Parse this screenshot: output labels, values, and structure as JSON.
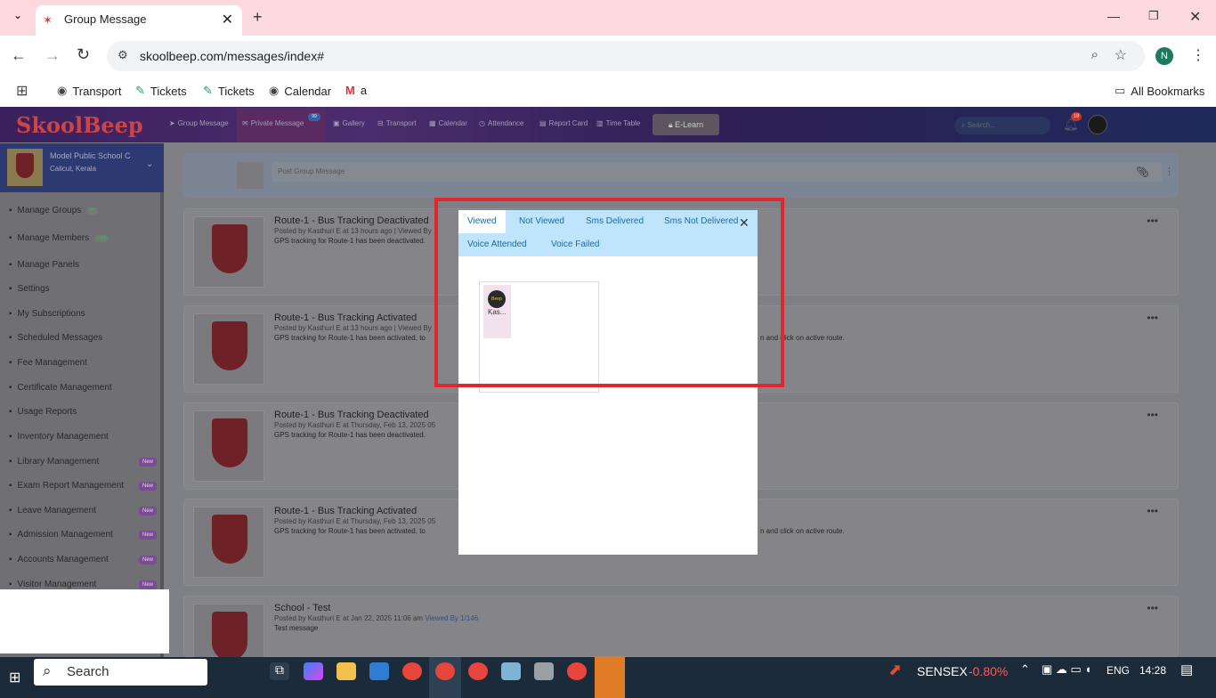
{
  "browser": {
    "tab_title": "Group Message",
    "url": "skoolbeep.com/messages/index#",
    "profile_initial": "N",
    "bookmarks": [
      "Transport",
      "Tickets",
      "Tickets",
      "Calendar",
      "a"
    ],
    "all_bookmarks": "All Bookmarks"
  },
  "app": {
    "logo": "SkoolBeep",
    "nav": [
      "Group Message",
      "Private Message",
      "Gallery",
      "Transport",
      "Calendar",
      "Attendance",
      "Report Card",
      "Time Table"
    ],
    "elearn": "E-Learn",
    "search_placeholder": "Search...",
    "notif_count": "18",
    "private_badge": "99",
    "school_name": "Model Public School C",
    "school_location": "Calicut, Kerala",
    "post_placeholder": "Post Group Message",
    "new_label": "New"
  },
  "sidebar": [
    {
      "label": "Manage Groups",
      "badge": "60"
    },
    {
      "label": "Manage Members",
      "badge": "189"
    },
    {
      "label": "Manage Panels"
    },
    {
      "label": "Settings"
    },
    {
      "label": "My Subscriptions"
    },
    {
      "label": "Scheduled Messages"
    },
    {
      "label": "Fee Management"
    },
    {
      "label": "Certificate Management"
    },
    {
      "label": "Usage Reports"
    },
    {
      "label": "Inventory Management"
    },
    {
      "label": "Library Management",
      "new": true
    },
    {
      "label": "Exam Report Management",
      "new": true
    },
    {
      "label": "Leave Management",
      "new": true
    },
    {
      "label": "Admission Management",
      "new": true
    },
    {
      "label": "Accounts Management",
      "new": true
    },
    {
      "label": "Visitor Management",
      "new": true
    }
  ],
  "posts": [
    {
      "title": "Route-1 - Bus Tracking Deactivated",
      "meta": "Posted by Kasthuri E at 13 hours ago | Viewed By",
      "body": "GPS tracking for Route-1 has been deactivated."
    },
    {
      "title": "Route-1 - Bus Tracking Activated",
      "meta": "Posted by Kasthuri E at 13 hours ago | Viewed By",
      "body": "GPS tracking for Route-1 has been activated, to",
      "body_tail": "n and click on active route."
    },
    {
      "title": "Route-1 - Bus Tracking Deactivated",
      "meta": "Posted by Kasthuri E at Thursday, Feb 13, 2025 05",
      "body": "GPS tracking for Route-1 has been deactivated."
    },
    {
      "title": "Route-1 - Bus Tracking Activated",
      "meta": "Posted by Kasthuri E at Thursday, Feb 13, 2025 05",
      "body": "GPS tracking for Route-1 has been activated, to",
      "body_tail": "n and click on active route."
    },
    {
      "title": "School - Test",
      "meta": "Posted by Kasthuri E at Jan 22, 2025 11:06 am",
      "viewed": "Viewed By 1/146",
      "body": "Test message"
    }
  ],
  "modal": {
    "tabs": [
      "Viewed",
      "Not Viewed",
      "Sms Delivered",
      "Sms Not Delivered",
      "Voice Attended",
      "Voice Failed"
    ],
    "active_tab": "Viewed",
    "viewer_name": "Kas...",
    "avatar_text": "Beep"
  },
  "taskbar": {
    "search": "Search",
    "ticker": "SENSEX",
    "ticker_change": "-0.80%",
    "lang": "ENG",
    "time": "14:28"
  },
  "colors": {
    "accent_red": "#e0262e",
    "tab_blue": "#bee5fb",
    "ticker_red": "#ff5b5b"
  }
}
